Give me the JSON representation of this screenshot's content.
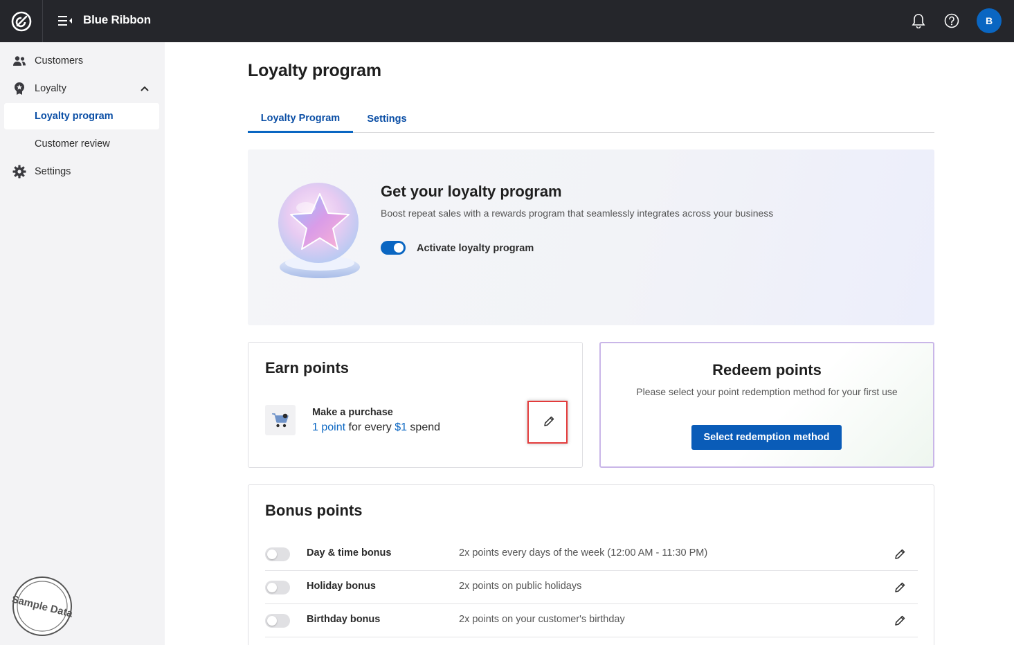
{
  "app": {
    "brand": "Blue Ribbon",
    "avatar_initial": "B",
    "accent": "#0a66c2",
    "topbar_bg": "#25262b"
  },
  "topbar": {
    "icons": [
      "logo-icon",
      "menu-collapse-icon",
      "bell-icon",
      "help-icon"
    ]
  },
  "sidebar": {
    "items": [
      {
        "label": "Customers",
        "icon": "customers-icon"
      },
      {
        "label": "Loyalty",
        "icon": "loyalty-badge-icon"
      },
      {
        "label": "Loyalty program",
        "active": true
      },
      {
        "label": "Customer review"
      },
      {
        "label": "Settings",
        "icon": "gear-icon"
      }
    ],
    "stamp_text": "Sample Data"
  },
  "main": {
    "title": "Loyalty program",
    "tabs": [
      {
        "label": "Loyalty Program",
        "active": true
      },
      {
        "label": "Settings",
        "active": false
      }
    ],
    "hero": {
      "title": "Get your loyalty program",
      "subtitle": "Boost repeat sales with a rewards program that seamlessly integrates across your business",
      "toggle_label": "Activate loyalty program",
      "toggle_on": true
    },
    "earn": {
      "title": "Earn points",
      "item_label": "Make a purchase",
      "rule_points": "1 point",
      "rule_mid": " for every ",
      "rule_amount": "$1",
      "rule_end": " spend"
    },
    "redeem": {
      "title": "Redeem points",
      "subtitle": "Please select your point redemption method for your first use",
      "button_label": "Select redemption method"
    },
    "bonus": {
      "title": "Bonus points",
      "rows": [
        {
          "name": "Day & time bonus",
          "desc": "2x points every days of the week (12:00 AM - 11:30 PM)",
          "enabled": false
        },
        {
          "name": "Holiday bonus",
          "desc": "2x points on public holidays",
          "enabled": false
        },
        {
          "name": "Birthday bonus",
          "desc": "2x points on your customer's birthday",
          "enabled": false
        }
      ]
    }
  }
}
